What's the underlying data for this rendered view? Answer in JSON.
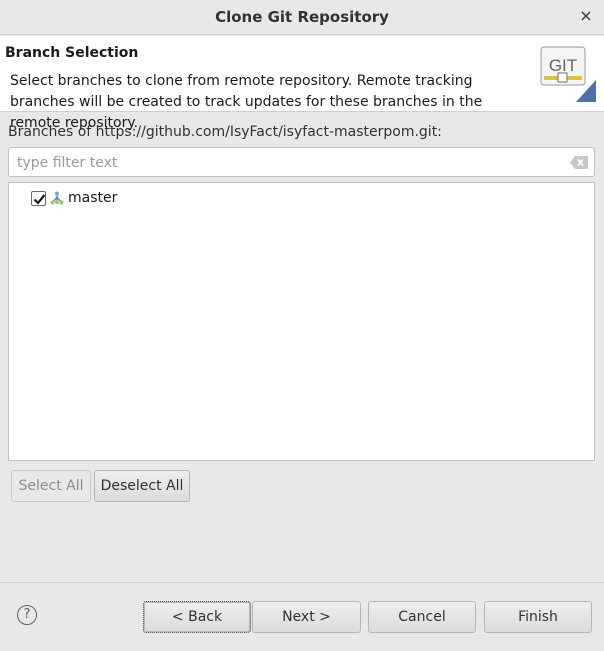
{
  "window": {
    "title": "Clone Git Repository",
    "close_glyph": "×"
  },
  "header": {
    "title": "Branch Selection",
    "description": "Select branches to clone from remote repository. Remote tracking branches will be created to track updates for these branches in the remote repository.",
    "logo_text": "GIT",
    "logo_icon": "git-logo-icon"
  },
  "branches": {
    "label": "Branches of https://github.com/IsyFact/isyfact-masterpom.git:",
    "filter_placeholder": "type filter text",
    "filter_value": "",
    "items": [
      {
        "label": "master",
        "checked": true,
        "icon": "branch-icon"
      }
    ]
  },
  "selection_buttons": {
    "select_all": "Select All",
    "deselect_all": "Deselect All"
  },
  "footer": {
    "help_glyph": "?",
    "back": "< Back",
    "next": "Next >",
    "cancel": "Cancel",
    "finish": "Finish"
  }
}
